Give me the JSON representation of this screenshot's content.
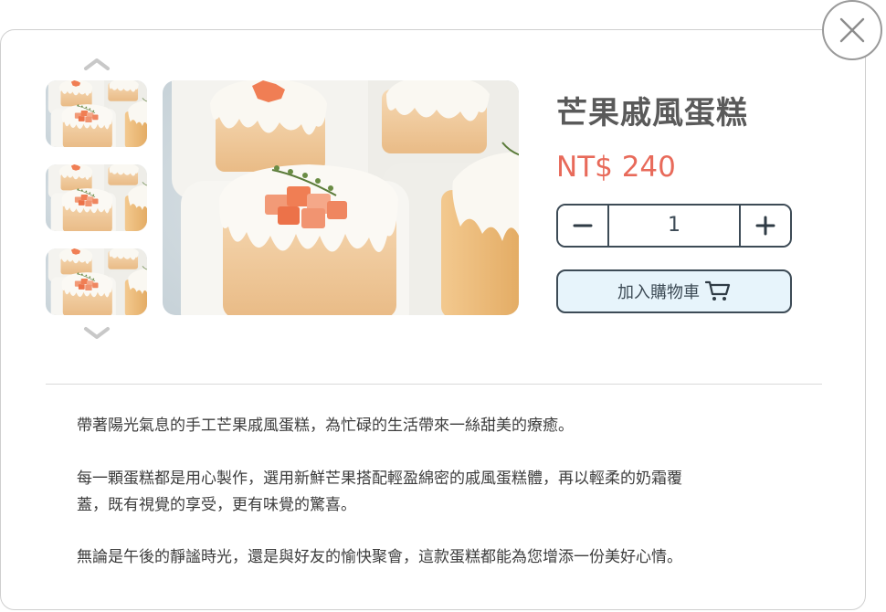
{
  "product": {
    "name": "芒果戚風蛋糕",
    "price": "NT$ 240",
    "quantity": "1"
  },
  "cart": {
    "add_label": "加入購物車"
  },
  "description": {
    "p1": "帶著陽光氣息的手工芒果戚風蛋糕，為忙碌的生活帶來一絲甜美的療癒。",
    "p2_line1": "每一顆蛋糕都是用心製作，選用新鮮芒果搭配輕盈綿密的戚風蛋糕體，再以輕柔的奶霜覆",
    "p2_line2": "蓋，既有視覺的享受，更有味覺的驚喜。",
    "p3": "無論是午後的靜謐時光，還是與好友的愉快聚會，這款蛋糕都能為您增添一份美好心情。"
  },
  "icons": {
    "close": "close-icon",
    "up": "chevron-up-icon",
    "down": "chevron-down-icon",
    "minus": "minus-icon",
    "plus": "plus-icon",
    "cart": "cart-icon"
  },
  "colors": {
    "price": "#e86a5a",
    "accent_border": "#3d4b56",
    "cart_bg": "#e7f4fb"
  }
}
